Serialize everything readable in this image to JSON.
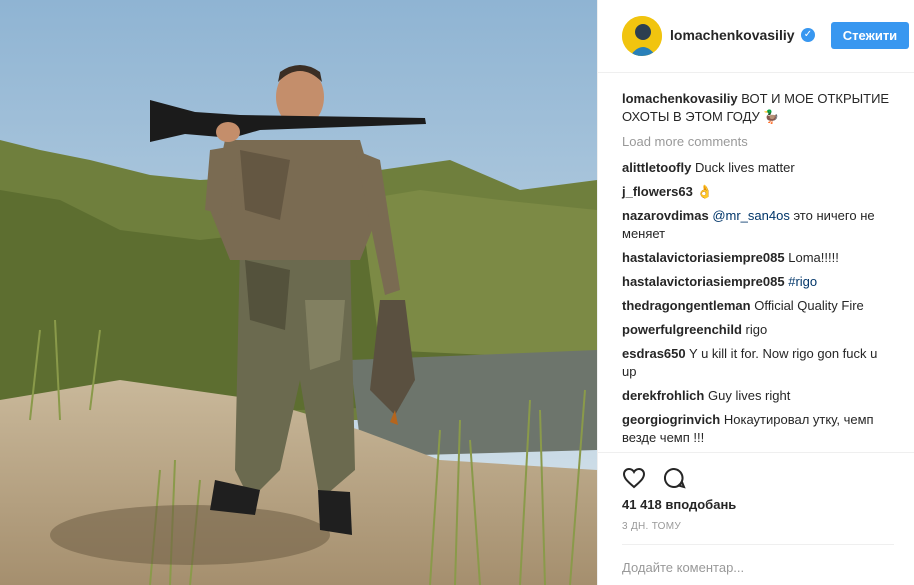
{
  "post": {
    "username": "lomachenkovasiliy",
    "verified": true,
    "follow_label": "Стежити",
    "caption": "ВОТ И МОЕ ОТКРЫТИЕ ОХОТЫ В ЭТОМ ГОДУ 🦆",
    "load_more": "Load more comments",
    "likes": "41 418 вподобань",
    "time": "3 ДН. ТОМУ",
    "comment_placeholder": "Додайте коментар..."
  },
  "comments": [
    {
      "user": "alittletoofly",
      "text": "Duck lives matter"
    },
    {
      "user": "j_flowers63",
      "text": "👌"
    },
    {
      "user": "nazarovdimas",
      "mention": "@mr_san4os",
      "text": " это ничего не меняет"
    },
    {
      "user": "hastalavictoriasiempre085",
      "text": "Loma!!!!!"
    },
    {
      "user": "hastalavictoriasiempre085",
      "mention": "#rigo",
      "text": ""
    },
    {
      "user": "thedragongentleman",
      "text": "Official Quality Fire"
    },
    {
      "user": "powerfulgreenchild",
      "text": "rigo"
    },
    {
      "user": "esdras650",
      "text": "Y u kill it for. Now rigo gon fuck u up"
    },
    {
      "user": "derekfrohlich",
      "text": "Guy lives right"
    },
    {
      "user": "georgiogrinvich",
      "text": "Нокаутировал утку, чемп везде чемп !!!"
    }
  ],
  "colors": {
    "accent": "#3897f0",
    "mention": "#003569",
    "muted": "#999999"
  },
  "icons": {
    "like": "heart-icon",
    "comment": "comment-bubble-icon",
    "verified": "verified-badge-icon",
    "avatar": "avatar"
  }
}
